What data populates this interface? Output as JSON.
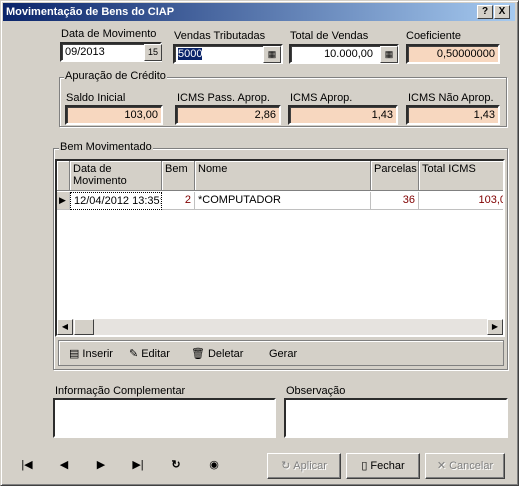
{
  "window": {
    "title": "Movimentação de Bens do CIAP",
    "help_btn": "?",
    "close_btn": "X"
  },
  "header": {
    "data_movimento_label": "Data de Movimento",
    "data_movimento_value": "09/2013",
    "vendas_tributadas_label": "Vendas Tributadas",
    "vendas_tributadas_value": "5000",
    "total_vendas_label": "Total de Vendas",
    "total_vendas_value": "10.000,00",
    "coeficiente_label": "Coeficiente",
    "coeficiente_value": "0,50000000"
  },
  "apuracao": {
    "title": "Apuração de Crédito",
    "saldo_inicial_label": "Saldo Inicial",
    "saldo_inicial_value": "103,00",
    "icms_pass_label": "ICMS Pass. Aprop.",
    "icms_pass_value": "2,86",
    "icms_aprop_label": "ICMS Aprop.",
    "icms_aprop_value": "1,43",
    "icms_nao_label": "ICMS Não Aprop.",
    "icms_nao_value": "1,43"
  },
  "bem": {
    "title": "Bem Movimentado",
    "columns": [
      "Data de Movimento",
      "Bem",
      "Nome",
      "Parcelas",
      "Total ICMS"
    ],
    "rows": [
      {
        "data": "12/04/2012 13:35:",
        "bem": "2",
        "nome": "*COMPUTADOR",
        "parcelas": "36",
        "total": "103,0"
      }
    ],
    "toolbar": {
      "inserir": "Inserir",
      "editar": "Editar",
      "deletar": "Deletar",
      "gerar": "Gerar"
    }
  },
  "info_label": "Informação Complementar",
  "obs_label": "Observação",
  "nav": {
    "first": "|◀",
    "prev": "◀",
    "next": "▶",
    "last": "▶|",
    "refresh": "↻"
  },
  "buttons": {
    "aplicar": "Aplicar",
    "fechar": "Fechar",
    "cancelar": "Cancelar"
  },
  "colors": {
    "readonly_field": "#f7d7bf",
    "title_bar": "#0a246a",
    "highlight_value": "#800000"
  }
}
